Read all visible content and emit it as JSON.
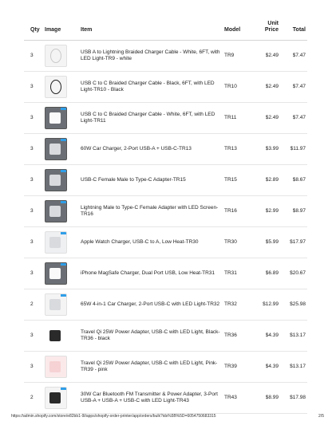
{
  "headers": {
    "qty": "Qty",
    "image": "Image",
    "item": "Item",
    "model": "Model",
    "unit_price": "Unit Price",
    "total": "Total"
  },
  "rows": [
    {
      "qty": "3",
      "item": "USB A to Lightning Braided Charger Cable - White, 6FT, with LED Light-TR9 - white",
      "model": "TR9",
      "price": "$2.49",
      "total": "$7.47",
      "icon": "white-cable-product-icon"
    },
    {
      "qty": "3",
      "item": "USB C to C Braided Charger Cable - Black, 6FT, with LED Light-TR10 - Black",
      "model": "TR10",
      "price": "$2.49",
      "total": "$7.47",
      "icon": "black-cable-product-icon"
    },
    {
      "qty": "3",
      "item": "USB C to C Braided Charger Cable - White, 6FT, with LED Light-TR11",
      "model": "TR11",
      "price": "$2.49",
      "total": "$7.47",
      "icon": "white-cable-box-product-icon"
    },
    {
      "qty": "3",
      "item": "60W Car Charger, 2-Port USB-A + USB-C-TR13",
      "model": "TR13",
      "price": "$3.99",
      "total": "$11.97",
      "icon": "car-charger-product-icon"
    },
    {
      "qty": "3",
      "item": "USB-C Female Male to Type-C Adapter-TR15",
      "model": "TR15",
      "price": "$2.89",
      "total": "$8.67",
      "icon": "adapter-product-icon"
    },
    {
      "qty": "3",
      "item": "Lightning Male to Type-C Female Adapter with LED Screen-TR16",
      "model": "TR16",
      "price": "$2.99",
      "total": "$8.97",
      "icon": "led-adapter-product-icon"
    },
    {
      "qty": "3",
      "item": "Apple Watch Charger, USB-C to A, Low Heat-TR30",
      "model": "TR30",
      "price": "$5.99",
      "total": "$17.97",
      "icon": "watch-charger-product-icon"
    },
    {
      "qty": "3",
      "item": "iPhone MagSafe Charger, Dual Port USB, Low Heat-TR31",
      "model": "TR31",
      "price": "$6.89",
      "total": "$20.67",
      "icon": "magsafe-charger-product-icon"
    },
    {
      "qty": "2",
      "item": "65W 4-in-1 Car Charger, 2-Port USB-C with LED Light-TR32",
      "model": "TR32",
      "price": "$12.99",
      "total": "$25.98",
      "icon": "car-charger-4in1-product-icon"
    },
    {
      "qty": "3",
      "item": "Travel Qi 25W Power Adapter, USB-C with LED Light, Black-TR36 - black",
      "model": "TR36",
      "price": "$4.39",
      "total": "$13.17",
      "icon": "black-power-adapter-product-icon"
    },
    {
      "qty": "3",
      "item": "Travel Qi 25W Power Adapter, USB-C with LED Light, Pink-TR39 - pink",
      "model": "TR39",
      "price": "$4.39",
      "total": "$13.17",
      "icon": "pink-power-adapter-product-icon"
    },
    {
      "qty": "2",
      "item": "30W Car Bluetooth FM Transmitter & Power Adapter, 3-Port USB-A + USB-A + USB-C with LED Light-TR43",
      "model": "TR43",
      "price": "$8.99",
      "total": "$17.98",
      "icon": "fm-transmitter-product-icon"
    }
  ],
  "footer": {
    "url": "https://admin.shopify.com/store/e82bb1-9l/apps/shopify-order-printer/app/orders/bulk?ids%5B%5D=6054750683315",
    "page": "2/5"
  }
}
